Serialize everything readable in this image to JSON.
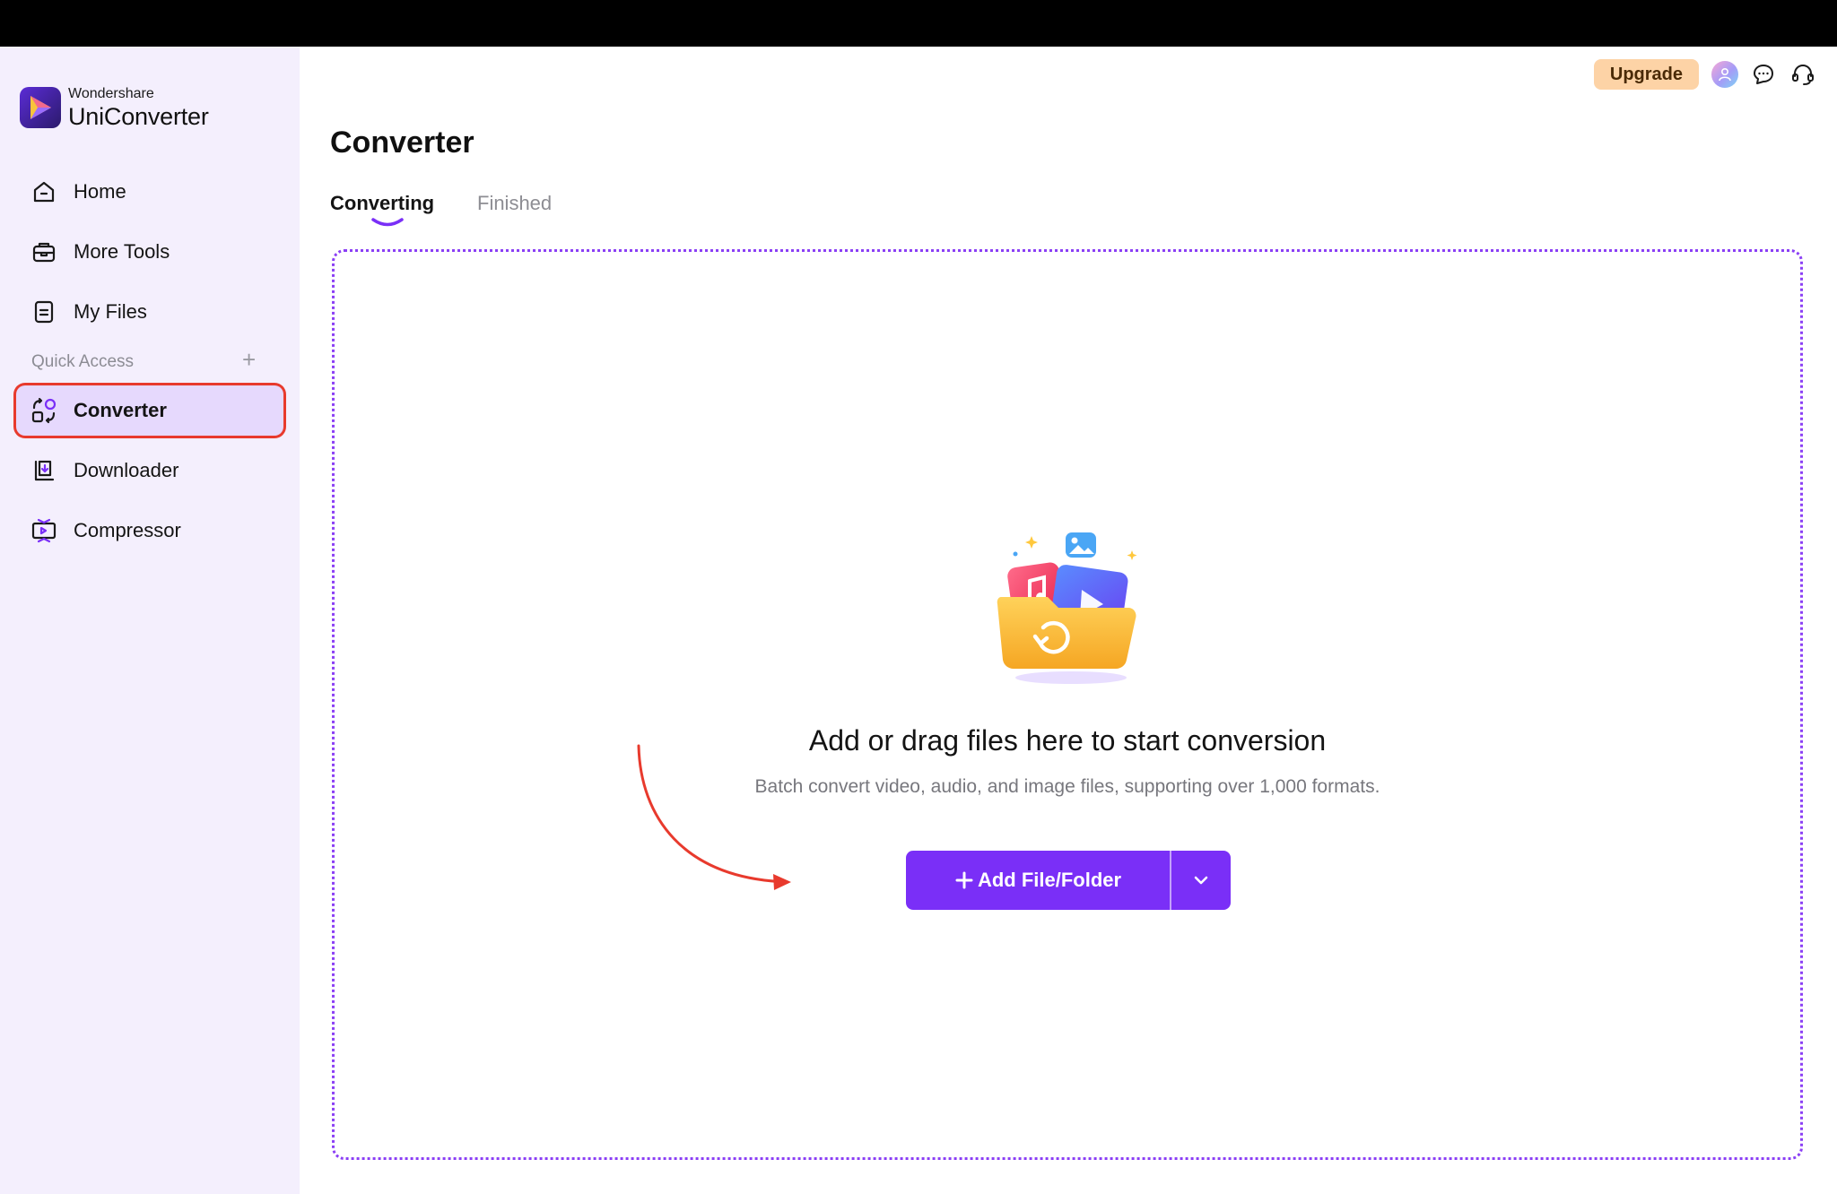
{
  "brand": {
    "company": "Wondershare",
    "product": "UniConverter"
  },
  "sidebar": {
    "items": [
      {
        "label": "Home",
        "icon": "home-icon"
      },
      {
        "label": "More Tools",
        "icon": "toolbox-icon"
      },
      {
        "label": "My Files",
        "icon": "file-icon"
      }
    ],
    "quick_access_label": "Quick Access",
    "quick_items": [
      {
        "label": "Converter",
        "icon": "converter-icon",
        "active": true
      },
      {
        "label": "Downloader",
        "icon": "downloader-icon"
      },
      {
        "label": "Compressor",
        "icon": "compressor-icon"
      }
    ]
  },
  "header": {
    "upgrade_label": "Upgrade"
  },
  "main": {
    "title": "Converter",
    "tabs": [
      {
        "label": "Converting",
        "active": true
      },
      {
        "label": "Finished"
      }
    ],
    "headline": "Add or drag files here to start conversion",
    "subline": "Batch convert video, audio, and image files, supporting over 1,000 formats.",
    "add_button_label": "Add File/Folder"
  },
  "colors": {
    "accent": "#7a2ff7",
    "sidebar_bg": "#f4effd",
    "active_item_bg": "#e6d9fd",
    "highlight_outline": "#e83a2d",
    "upgrade_bg": "#fdd3a6"
  }
}
